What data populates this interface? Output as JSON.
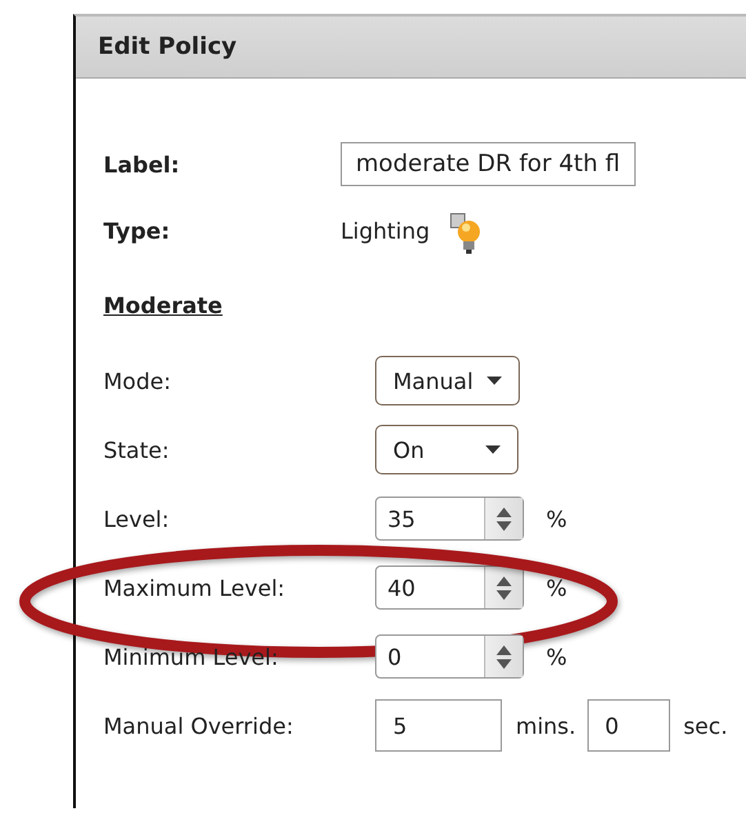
{
  "title": "Edit Policy",
  "label": {
    "caption": "Label:",
    "value": "moderate DR for 4th fl"
  },
  "type": {
    "caption": "Type:",
    "value": "Lighting"
  },
  "section": "Moderate",
  "fields": [
    {
      "kind": "select",
      "caption": "Mode:",
      "value": "Manual"
    },
    {
      "kind": "select",
      "caption": "State:",
      "value": "On"
    },
    {
      "kind": "spinner",
      "caption": "Level:",
      "value": "35",
      "unit": "%",
      "highlighted": false
    },
    {
      "kind": "spinner",
      "caption": "Maximum Level:",
      "value": "40",
      "unit": "%",
      "highlighted": true
    },
    {
      "kind": "spinner",
      "caption": "Minimum Level:",
      "value": "0",
      "unit": "%",
      "highlighted": false
    },
    {
      "kind": "duration",
      "caption": "Manual Override:",
      "minutes": "5",
      "minutes_unit": "mins.",
      "seconds": "0",
      "seconds_unit": "sec."
    }
  ]
}
